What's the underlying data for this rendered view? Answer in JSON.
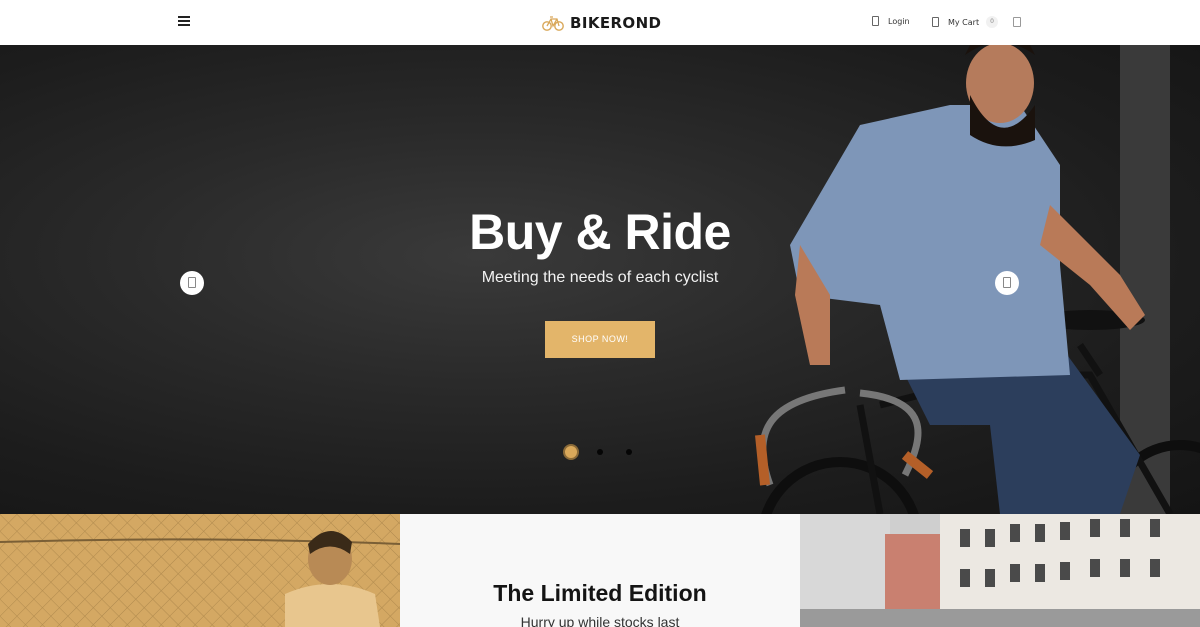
{
  "header": {
    "logo_text": "BIKEROND",
    "login_label": "Login",
    "cart_label": "My Cart",
    "cart_count": "0",
    "icons": [
      "menu-icon",
      "bicycle-icon",
      "user-icon",
      "cart-icon",
      "search-icon"
    ]
  },
  "hero": {
    "title": "Buy & Ride",
    "subtitle": "Meeting the needs of each cyclist",
    "cta_label": "SHOP NOW!",
    "slide_count": 3,
    "active_slide": 1
  },
  "promo": {
    "title": "The Limited Edition",
    "subtitle": "Hurry up while stocks last"
  },
  "colors": {
    "accent": "#e3b56a",
    "hero_bg": "#2a2a2a",
    "promo_left_bg": "#d4a863",
    "promo_mid_bg": "#f8f8f8",
    "text_dark": "#1a1a1a"
  }
}
